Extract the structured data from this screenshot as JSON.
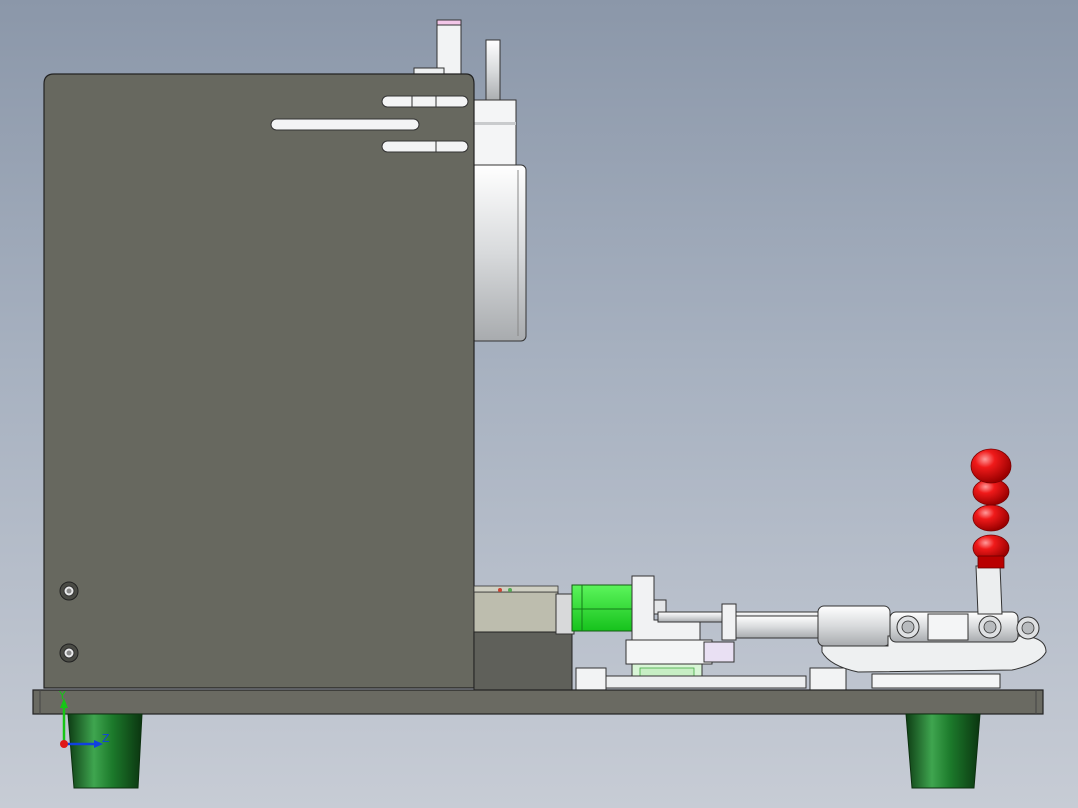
{
  "view": {
    "background_top": "#8b97a9",
    "background_bottom": "#c7ccd5"
  },
  "model": {
    "plate_color": "#67685f",
    "base_color": "#6a6a62",
    "feet_color": "#1d6b2a",
    "handle_color": "#e01010",
    "slider_color": "#22e22a",
    "metal_color": "#e6e8ea"
  },
  "triad": {
    "y_label": "Y",
    "z_label": "Z",
    "y_color": "#16c516",
    "z_color": "#1040e0",
    "x_color": "#e01818"
  }
}
